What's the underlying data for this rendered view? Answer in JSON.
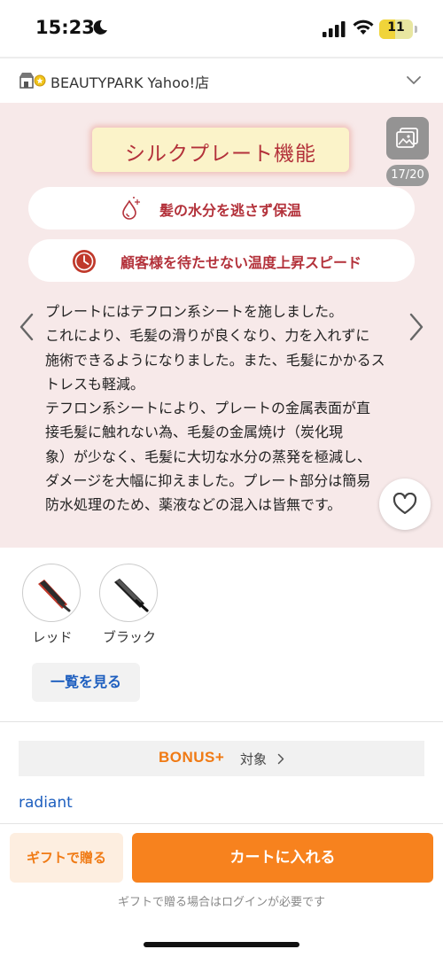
{
  "status_bar": {
    "time": "15:23",
    "battery": "11",
    "icons": [
      "moon-icon",
      "signal-icon",
      "wifi-icon",
      "battery-icon"
    ]
  },
  "store": {
    "name": "BEAUTYPARK Yahoo!店",
    "icon": "store-icon",
    "chevron": "chevron-down-icon"
  },
  "carousel": {
    "feature_title": "シルクプレート機能",
    "counter": "17/20",
    "pills": [
      {
        "icon": "water-drop-icon",
        "text": "髪の水分を逃さず保温"
      },
      {
        "icon": "clock-icon",
        "text": "顧客様を待たせない温度上昇スピード"
      }
    ],
    "description_lines": [
      "プレートにはテフロン系シートを施しました。",
      "これにより、毛髪の滑りが良くなり、力を入れずに",
      "施術できるようになりました。また、毛髪にかかるス",
      "トレスも軽減。",
      "テフロン系シートにより、プレートの金属表面が直",
      "接毛髪に触れない為、毛髪の金属焼け（炭化現",
      "象）が少なく、毛髪に大切な水分の蒸発を極減し、",
      "ダメージを大幅に抑えました。プレート部分は簡易",
      "防水処理のため、薬液などの混入は皆無です。"
    ]
  },
  "variants": [
    {
      "label": "レッド",
      "color": "#c0392b"
    },
    {
      "label": "ブラック",
      "color": "#222222"
    }
  ],
  "view_all_label": "一覧を見る",
  "bonus": {
    "logo": "BONUS+",
    "text": "対象",
    "accent": "#f07a14"
  },
  "brand_link": "radiant",
  "bottom_bar": {
    "gift_label": "ギフトで贈る",
    "cart_label": "カートに入れる",
    "note": "ギフトで贈る場合はログインが必要です"
  },
  "colors": {
    "accent_orange": "#f7821e",
    "link_blue": "#1e5fbf",
    "title_red": "#b3313a",
    "carousel_bg": "#f7e9e9"
  }
}
